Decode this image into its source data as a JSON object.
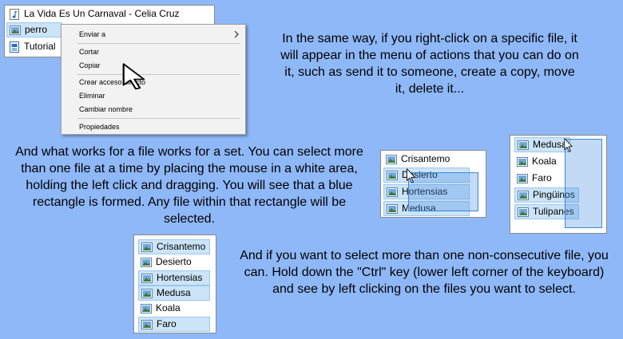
{
  "top_list": {
    "items": [
      {
        "label": "La Vida Es Un Carnaval - Celia Cruz",
        "icon": "music-file-icon"
      },
      {
        "label": "perro",
        "icon": "image-file-icon"
      },
      {
        "label": "Tutorial",
        "icon": "document-file-icon"
      }
    ]
  },
  "context_menu": {
    "items": [
      {
        "label": "Enviar a"
      },
      {
        "label": "Cortar"
      },
      {
        "label": "Copiar"
      },
      {
        "label": "Crear acceso directo"
      },
      {
        "label": "Eliminar"
      },
      {
        "label": "Cambiar nombre"
      },
      {
        "label": "Propiedades"
      }
    ]
  },
  "text_blocks": {
    "right_click": "In the same way, if you right-click on a specific file, it will appear in the menu of actions that you can do on it, such as send it to someone, create a copy, move it, delete it...",
    "drag_select": "And what works for a file works for a set. You can select more than one file at a time by placing the mouse in a white area, holding the left click and dragging. You will see that a blue rectangle is formed. Any file within that rectangle will be selected.",
    "ctrl_select": "And if you want to select more than one non-consecutive file, you can. Hold down the \"Ctrl\" key (lower left corner of the keyboard) and see by left clicking on the files you want to select."
  },
  "drag_list_a": {
    "items": [
      {
        "label": "Crisantemo"
      },
      {
        "label": "Desierto"
      },
      {
        "label": "Hortensias"
      },
      {
        "label": "Medusa"
      }
    ]
  },
  "drag_list_b": {
    "items": [
      {
        "label": "Medusa"
      },
      {
        "label": "Koala"
      },
      {
        "label": "Faro"
      },
      {
        "label": "Pingüinos"
      },
      {
        "label": "Tulipanes"
      }
    ]
  },
  "ctrl_list": {
    "items": [
      {
        "label": "Crisantemo"
      },
      {
        "label": "Desierto"
      },
      {
        "label": "Hortensias"
      },
      {
        "label": "Medusa"
      },
      {
        "label": "Koala"
      },
      {
        "label": "Faro"
      }
    ]
  },
  "colors": {
    "background": "#8fb8f8",
    "selection": "#cce4f7",
    "marquee": "#3a86d8"
  }
}
